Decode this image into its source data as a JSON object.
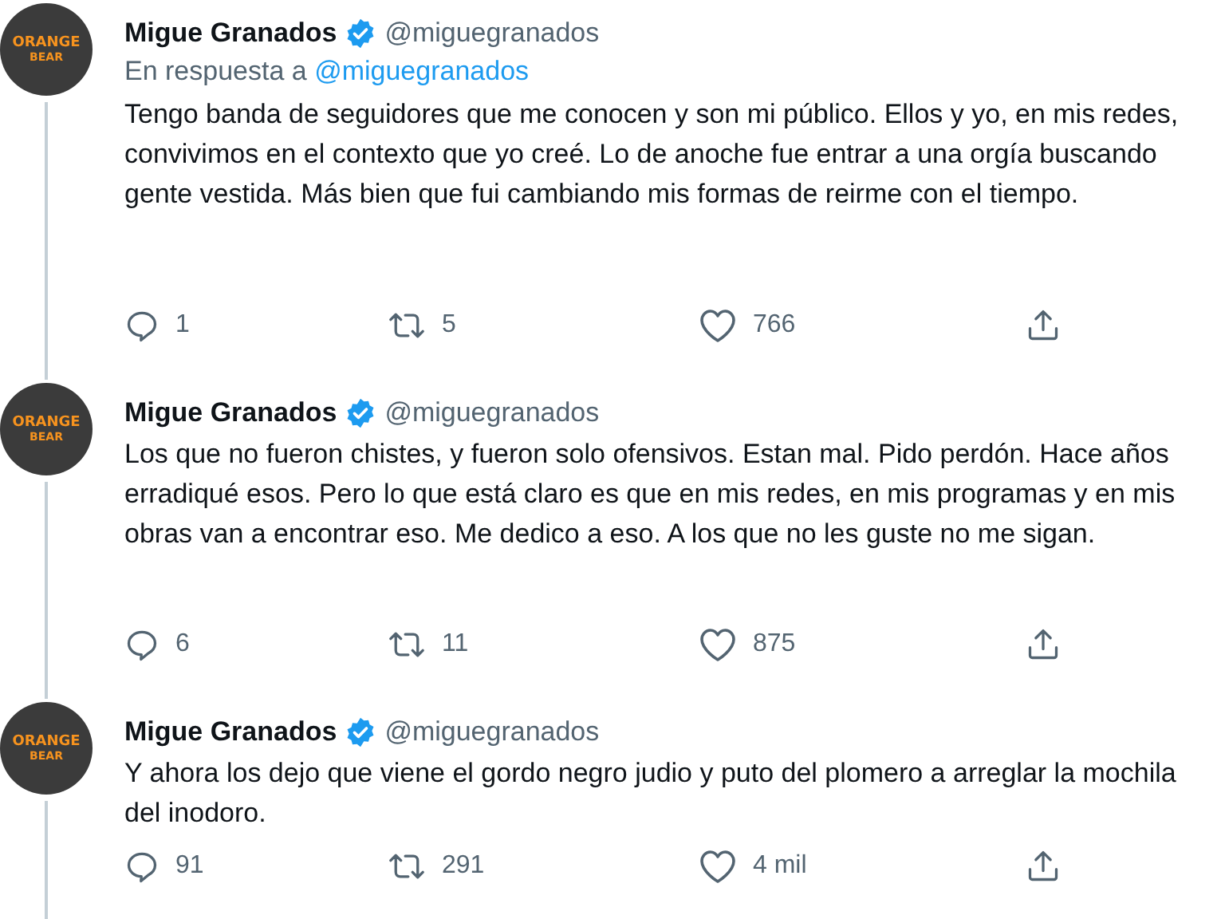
{
  "tweets": [
    {
      "author": {
        "name": "Migue Granados",
        "verified": true,
        "handle": "@miguegranados",
        "avatar_logo": [
          "ORANGE",
          "BEAR"
        ]
      },
      "reply_to": {
        "label": "En respuesta a",
        "handle": "@miguegranados"
      },
      "text": "Tengo banda de seguidores que me conocen y son mi público. Ellos y yo, en mis redes, convivimos en el contexto que yo creé. Lo de anoche fue entrar a una orgía buscando gente vestida. Más bien que fui cambiando mis formas de reirme con el tiempo.",
      "thread_line": true,
      "stats": {
        "replies": "1",
        "retweets": "5",
        "likes": "766"
      }
    },
    {
      "author": {
        "name": "Migue Granados",
        "verified": true,
        "handle": "@miguegranados",
        "avatar_logo": [
          "ORANGE",
          "BEAR"
        ]
      },
      "text": "Los que no fueron chistes, y fueron solo ofensivos. Estan mal. Pido perdón. Hace años erradiqué esos. Pero lo que está claro es que en mis redes, en mis programas y en mis obras van a encontrar eso. Me dedico a eso. A los que no les guste no me sigan.",
      "thread_line": true,
      "stats": {
        "replies": "6",
        "retweets": "11",
        "likes": "875"
      }
    },
    {
      "author": {
        "name": "Migue Granados",
        "verified": true,
        "handle": "@miguegranados",
        "avatar_logo": [
          "ORANGE",
          "BEAR"
        ]
      },
      "text": "Y ahora los dejo que viene el gordo negro judio y puto del plomero a arreglar la mochila del inodoro.",
      "thread_line": true,
      "stats": {
        "replies": "91",
        "retweets": "291",
        "likes": "4 mil"
      }
    }
  ]
}
